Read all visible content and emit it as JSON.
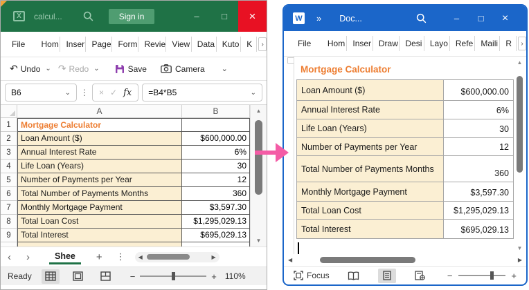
{
  "colors": {
    "excel_green": "#1F7246",
    "close_red": "#E81123",
    "word_blue": "#1B66C9",
    "accent_orange": "#ED7D31",
    "cell_cream": "#FBEFD3",
    "arrow_pink": "#F45CA6"
  },
  "icons": {
    "chevron_down": "⌄",
    "kebab": "⋮",
    "undo": "↶",
    "redo": "↷",
    "close": "×",
    "cancel": "×",
    "check": "✓",
    "fx": "fx",
    "nav_left": "‹",
    "nav_right": "›",
    "overflow": "›",
    "add": "+",
    "minimize": "–",
    "maximize": "□",
    "up": "▲",
    "down": "▼",
    "left": "◀",
    "right": "▶",
    "zoom_minus": "−",
    "zoom_plus": "+",
    "chevrons_right": "»"
  },
  "excel": {
    "window_title": "calcul...",
    "signin_label": "Sign in",
    "tabs": [
      "File",
      "Hom",
      "Inser",
      "Page",
      "Form",
      "Revie",
      "View",
      "Data",
      "Kuto",
      "K"
    ],
    "qat": {
      "undo": "Undo",
      "redo": "Redo",
      "save": "Save",
      "camera": "Camera"
    },
    "name_box": "B6",
    "formula": "=B4*B5",
    "col_headers": [
      "A",
      "B"
    ],
    "rows": [
      {
        "n": "1",
        "a": "Mortgage Calculator",
        "b": "",
        "heading": true
      },
      {
        "n": "2",
        "a": "Loan Amount ($)",
        "b": "$600,000.00"
      },
      {
        "n": "3",
        "a": "Annual Interest Rate",
        "b": "6%"
      },
      {
        "n": "4",
        "a": "Life Loan (Years)",
        "b": "30"
      },
      {
        "n": "5",
        "a": "Number of Payments per Year",
        "b": "12"
      },
      {
        "n": "6",
        "a": "Total Number of Payments Months",
        "b": "360"
      },
      {
        "n": "7",
        "a": "Monthly Mortgage Payment",
        "b": "$3,597.30"
      },
      {
        "n": "8",
        "a": "Total Loan Cost",
        "b": "$1,295,029.13"
      },
      {
        "n": "9",
        "a": "Total Interest",
        "b": "$695,029.13"
      }
    ],
    "sheet_tab": "Shee",
    "status": {
      "ready": "Ready",
      "zoom": "110%"
    }
  },
  "word": {
    "window_title": "Doc...",
    "tabs": [
      "File",
      "Hom",
      "Inser",
      "Draw",
      "Desi",
      "Layo",
      "Refe",
      "Maili",
      "R"
    ],
    "doc_heading": "Mortgage Calculator",
    "table": [
      {
        "label": "Loan Amount ($)",
        "value": "$600,000.00"
      },
      {
        "label": "Annual Interest Rate",
        "value": "6%"
      },
      {
        "label": "Life Loan (Years)",
        "value": "30"
      },
      {
        "label": "Number of Payments per Year",
        "value": "12"
      },
      {
        "label": "Total Number of Payments Months",
        "value": "360"
      },
      {
        "label": "Monthly Mortgage Payment",
        "value": "$3,597.30"
      },
      {
        "label": "Total Loan Cost",
        "value": "$1,295,029.13"
      },
      {
        "label": "Total Interest",
        "value": "$695,029.13"
      }
    ],
    "status": {
      "focus": "Focus"
    }
  }
}
